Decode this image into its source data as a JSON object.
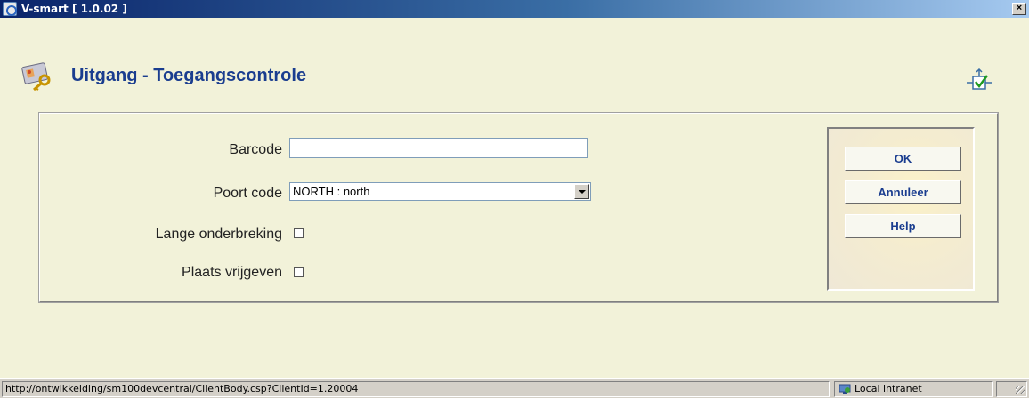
{
  "window": {
    "title": "V-smart [ 1.0.02 ]",
    "close_glyph": "×"
  },
  "header": {
    "title": "Uitgang - Toegangscontrole",
    "icon": "id-card-key-icon",
    "tool_icon": "workflow-check-icon"
  },
  "form": {
    "barcode_label": "Barcode",
    "barcode_value": "",
    "poort_label": "Poort code",
    "poort_selected": "NORTH : north",
    "lange_label": "Lange onderbreking",
    "lange_checked": false,
    "plaats_label": "Plaats vrijgeven",
    "plaats_checked": false
  },
  "buttons": {
    "ok": "OK",
    "annuleer": "Annuleer",
    "help": "Help"
  },
  "statusbar": {
    "url": "http://ontwikkelding/sm100devcentral/ClientBody.csp?ClientId=1.20004",
    "zone": "Local intranet"
  },
  "colors": {
    "title_blue": "#1a3d8f",
    "page_bg": "#f2f2d9",
    "titlebar_start": "#0a246a"
  }
}
